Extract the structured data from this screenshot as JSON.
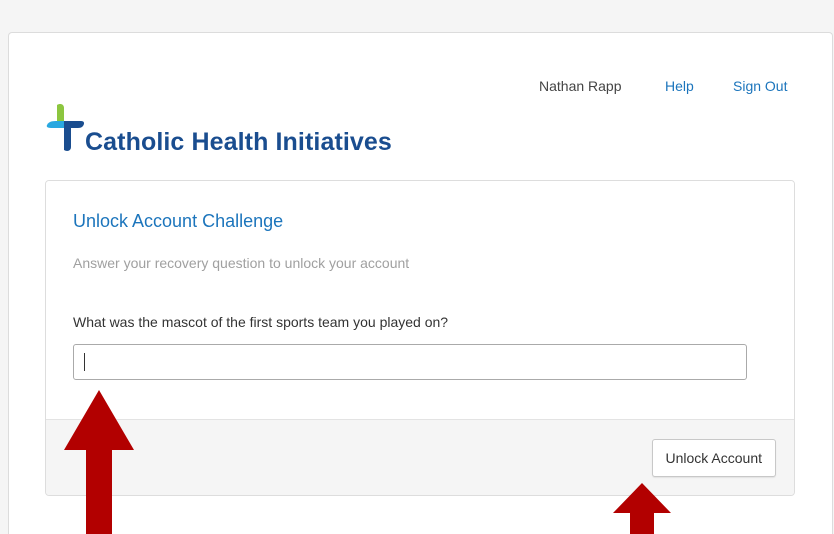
{
  "header": {
    "user_name": "Nathan Rapp",
    "help_label": "Help",
    "signout_label": "Sign Out",
    "logo_text": "Catholic Health Initiatives"
  },
  "form": {
    "title": "Unlock Account Challenge",
    "subtitle": "Answer your recovery question to unlock your account",
    "question": "What was the mascot of the first sports team you played on?",
    "answer_value": "",
    "submit_label": "Unlock Account"
  },
  "colors": {
    "accent": "#1c75bc",
    "logo_blue": "#1a4d8f",
    "logo_green": "#8cc63f",
    "arrow_red": "#b20000"
  },
  "icons": {
    "logo_mark": "chi-cross-logo-icon",
    "annotation": "red-arrow-up-icon"
  }
}
